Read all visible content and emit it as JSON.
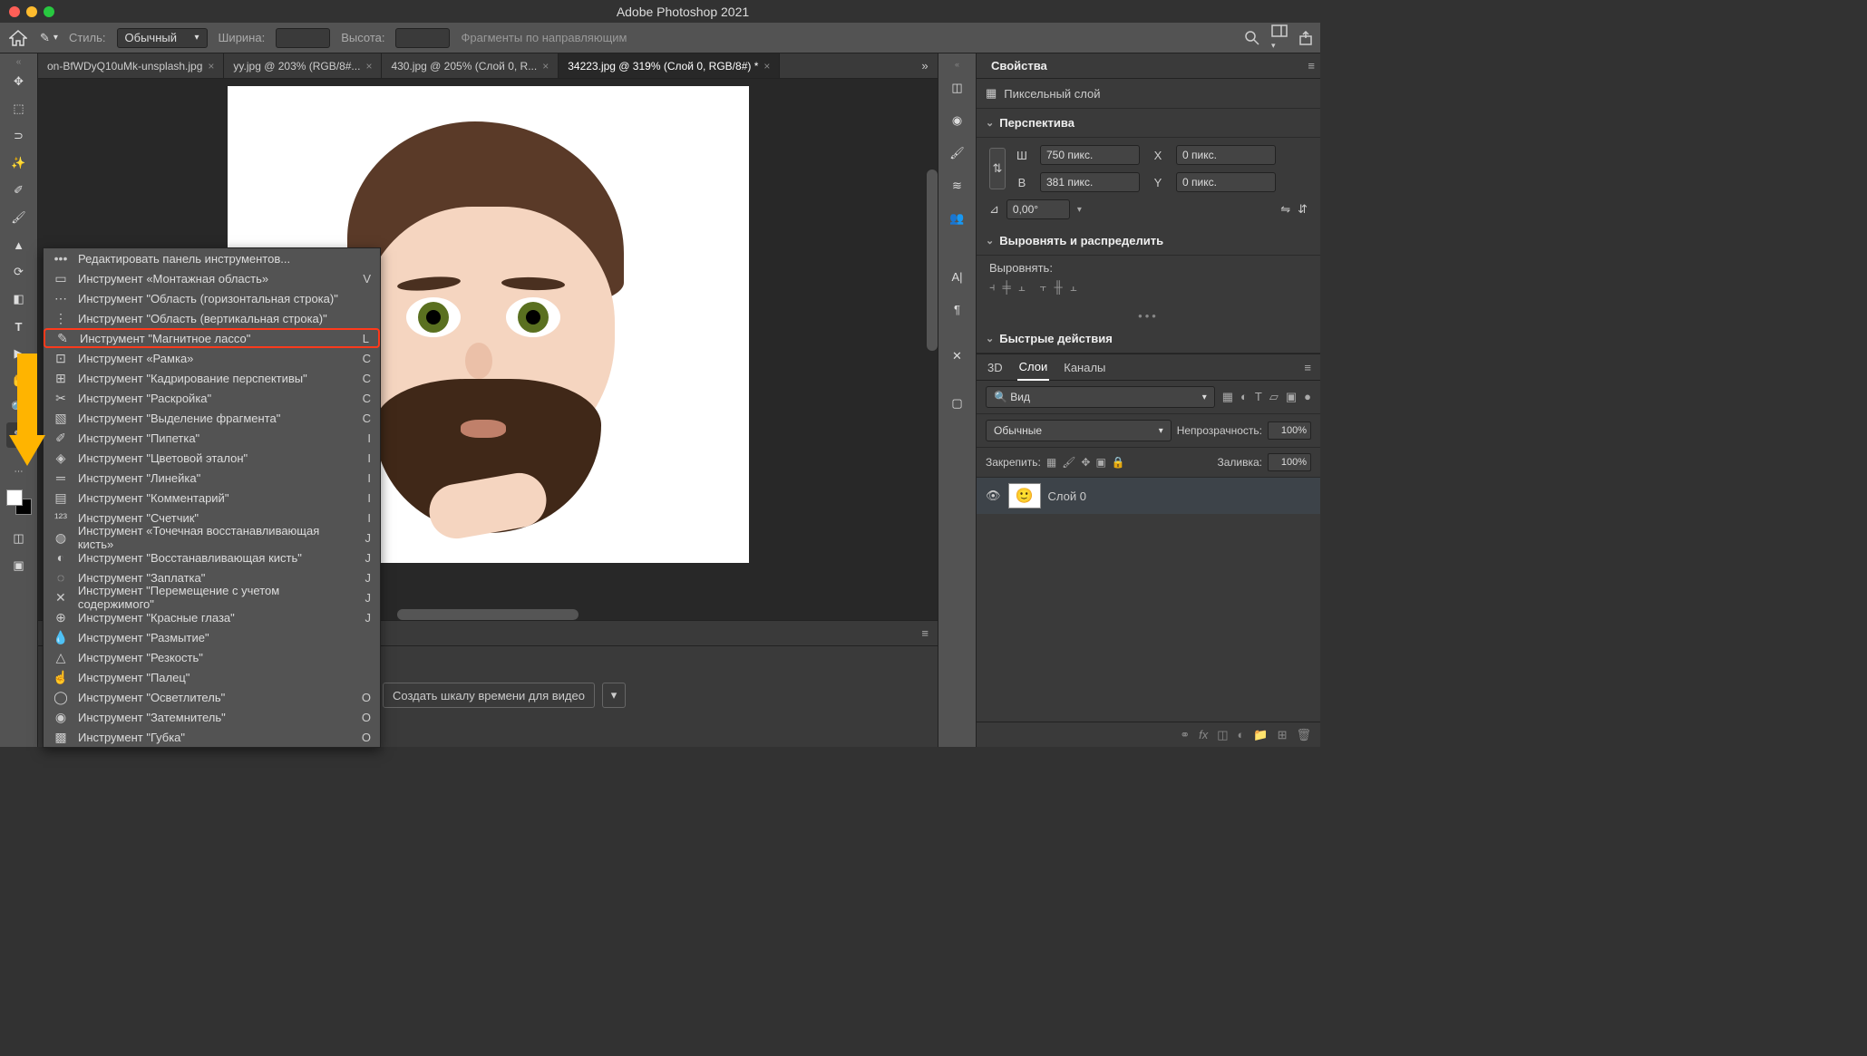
{
  "app": {
    "title": "Adobe Photoshop 2021"
  },
  "options": {
    "style_label": "Стиль:",
    "style_value": "Обычный",
    "width_label": "Ширина:",
    "height_label": "Высота:",
    "snap_label": "Фрагменты по направляющим"
  },
  "tabs": [
    {
      "label": "on-BfWDyQ10uMk-unsplash.jpg",
      "active": false
    },
    {
      "label": "yy.jpg @ 203% (RGB/8#...",
      "active": false
    },
    {
      "label": "430.jpg @ 205% (Слой 0, R...",
      "active": false
    },
    {
      "label": "34223.jpg @ 319% (Слой 0, RGB/8#) *",
      "active": true
    }
  ],
  "flyout": {
    "edit": "Редактировать панель инструментов...",
    "items": [
      {
        "label": "Инструмент «Монтажная область»",
        "key": "V",
        "icon": "▭"
      },
      {
        "label": "Инструмент \"Область (горизонтальная строка)\"",
        "key": "",
        "icon": "⋯"
      },
      {
        "label": "Инструмент \"Область (вертикальная строка)\"",
        "key": "",
        "icon": "⋮"
      },
      {
        "label": "Инструмент \"Магнитное лассо\"",
        "key": "L",
        "icon": "✎",
        "highlight": true
      },
      {
        "label": "Инструмент «Рамка»",
        "key": "C",
        "icon": "⊡"
      },
      {
        "label": "Инструмент \"Кадрирование перспективы\"",
        "key": "C",
        "icon": "⊞"
      },
      {
        "label": "Инструмент \"Раскройка\"",
        "key": "C",
        "icon": "✂"
      },
      {
        "label": "Инструмент \"Выделение фрагмента\"",
        "key": "C",
        "icon": "▧"
      },
      {
        "label": "Инструмент \"Пипетка\"",
        "key": "I",
        "icon": "✐"
      },
      {
        "label": "Инструмент \"Цветовой эталон\"",
        "key": "I",
        "icon": "◈"
      },
      {
        "label": "Инструмент \"Линейка\"",
        "key": "I",
        "icon": "═"
      },
      {
        "label": "Инструмент \"Комментарий\"",
        "key": "I",
        "icon": "▤"
      },
      {
        "label": "Инструмент \"Счетчик\"",
        "key": "I",
        "icon": "¹²³"
      },
      {
        "label": "Инструмент «Точечная восстанавливающая кисть»",
        "key": "J",
        "icon": "◍"
      },
      {
        "label": "Инструмент \"Восстанавливающая кисть\"",
        "key": "J",
        "icon": "◐"
      },
      {
        "label": "Инструмент \"Заплатка\"",
        "key": "J",
        "icon": "◌"
      },
      {
        "label": "Инструмент \"Перемещение с учетом содержимого\"",
        "key": "J",
        "icon": "✕"
      },
      {
        "label": "Инструмент \"Красные глаза\"",
        "key": "J",
        "icon": "⊕"
      },
      {
        "label": "Инструмент \"Размытие\"",
        "key": "",
        "icon": "💧"
      },
      {
        "label": "Инструмент \"Резкость\"",
        "key": "",
        "icon": "△"
      },
      {
        "label": "Инструмент \"Палец\"",
        "key": "",
        "icon": "☝"
      },
      {
        "label": "Инструмент \"Осветлитель\"",
        "key": "O",
        "icon": "◯"
      },
      {
        "label": "Инструмент \"Затемнитель\"",
        "key": "O",
        "icon": "◉"
      },
      {
        "label": "Инструмент \"Губка\"",
        "key": "O",
        "icon": "▩"
      }
    ]
  },
  "timeline": {
    "create_label": "Создать шкалу времени для видео"
  },
  "properties": {
    "panel_title": "Свойства",
    "layer_kind": "Пиксельный слой",
    "transform_section": "Перспектива",
    "w_label": "Ш",
    "w_value": "750 пикс.",
    "h_label": "В",
    "h_value": "381 пикс.",
    "x_label": "X",
    "x_value": "0 пикс.",
    "y_label": "Y",
    "y_value": "0 пикс.",
    "angle_value": "0,00°",
    "align_section": "Выровнять и распределить",
    "align_label": "Выровнять:",
    "quick_section": "Быстрые действия"
  },
  "layers": {
    "tab_3d": "3D",
    "tab_layers": "Слои",
    "tab_channels": "Каналы",
    "filter_value": "Вид",
    "blend_value": "Обычные",
    "opacity_label": "Непрозрачность:",
    "opacity_value": "100%",
    "lock_label": "Закрепить:",
    "fill_label": "Заливка:",
    "fill_value": "100%",
    "layer0": "Слой 0"
  }
}
